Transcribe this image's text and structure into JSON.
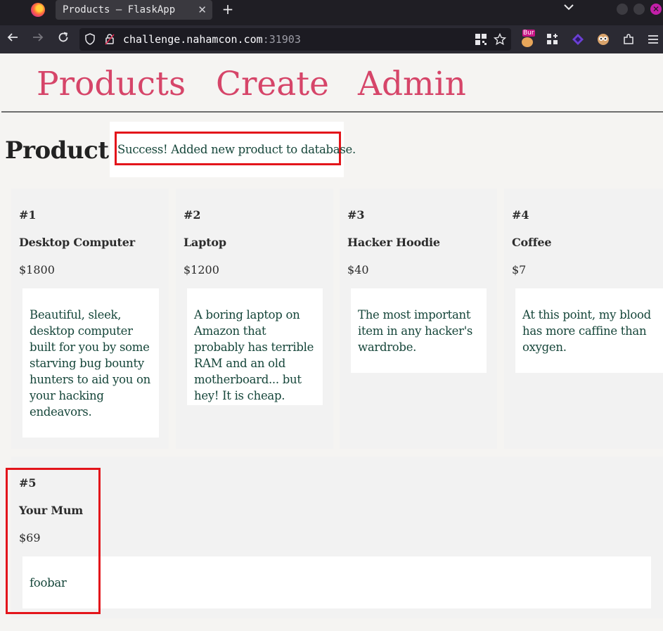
{
  "browser": {
    "tab_title": "Products – FlaskApp",
    "tab_close": "✕",
    "new_tab": "+",
    "tab_list": "⌄",
    "url_host": "challenge.nahamcon.com",
    "url_rest": ":31903",
    "burp_badge": "Bur",
    "window_close": "✕"
  },
  "nav": {
    "products": "Products",
    "create": "Create",
    "admin": "Admin"
  },
  "page": {
    "title": "Products",
    "flash": "Success! Added new product to database."
  },
  "products": [
    {
      "id": "#1",
      "name": "Desktop Computer",
      "price": "$1800",
      "description": "Beautiful, sleek, desktop computer built for you by some starving bug bounty hunters to aid you on your hacking endeavors."
    },
    {
      "id": "#2",
      "name": "Laptop",
      "price": "$1200",
      "description": "A boring laptop on Amazon that probably has terrible RAM and an old motherboard... but hey! It is cheap."
    },
    {
      "id": "#3",
      "name": "Hacker Hoodie",
      "price": "$40",
      "description": "The most important item in any hacker's wardrobe."
    },
    {
      "id": "#4",
      "name": "Coffee",
      "price": "$7",
      "description": "At this point, my blood has more caffine than oxygen."
    },
    {
      "id": "#5",
      "name": "Your Mum",
      "price": "$69",
      "description": "foobar"
    }
  ],
  "colors": {
    "link": "#d64569",
    "description_text": "#16463a",
    "highlight": "#e3151b"
  }
}
